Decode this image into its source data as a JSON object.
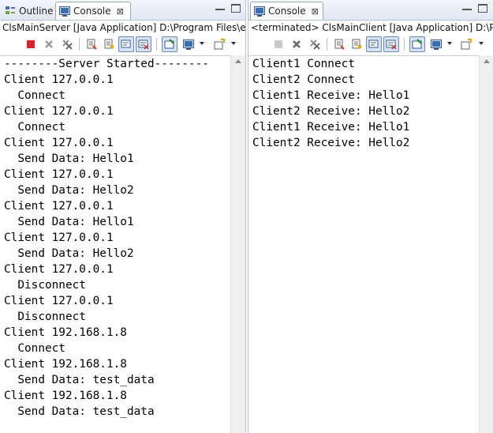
{
  "left": {
    "tabs": [
      {
        "label": "Outline",
        "icon": "outline-icon",
        "active": false
      },
      {
        "label": "Console",
        "icon": "console-icon",
        "active": true,
        "close": "⊠"
      }
    ],
    "title": "ClsMainServer [Java Application] D:\\Program Files\\ec",
    "lines": [
      "--------Server Started--------",
      "Client 127.0.0.1",
      "  Connect",
      "Client 127.0.0.1",
      "  Connect",
      "Client 127.0.0.1",
      "  Send Data: Hello1",
      "Client 127.0.0.1",
      "  Send Data: Hello2",
      "Client 127.0.0.1",
      "  Send Data: Hello1",
      "Client 127.0.0.1",
      "  Send Data: Hello2",
      "Client 127.0.0.1",
      "  Disconnect",
      "Client 127.0.0.1",
      "  Disconnect",
      "Client 192.168.1.8",
      "  Connect",
      "Client 192.168.1.8",
      "  Send Data: test_data",
      "Client 192.168.1.8",
      "  Send Data: test_data"
    ]
  },
  "right": {
    "tabs": [
      {
        "label": "Console",
        "icon": "console-icon",
        "active": true,
        "close": "⊠"
      }
    ],
    "title": "<terminated> ClsMainClient [Java Application] D:\\Pro",
    "lines": [
      "Client1 Connect",
      "Client2 Connect",
      "Client1 Receive: Hello1",
      "Client2 Receive: Hello2",
      "Client1 Receive: Hello1",
      "Client2 Receive: Hello2"
    ]
  },
  "toolbar_icons": [
    "terminate-icon",
    "remove-launch-icon",
    "remove-all-terminated-icon",
    "clear-console-icon",
    "scroll-lock-icon",
    "word-wrap-icon",
    "show-on-output-icon",
    "pin-console-icon",
    "display-selected-console-icon",
    "open-console-icon"
  ],
  "colors": {
    "terminate_active": "#d9232a",
    "terminate_disabled": "#c9c9c9",
    "tab_bg": "#e3e9f3",
    "border": "#9aaabd"
  }
}
